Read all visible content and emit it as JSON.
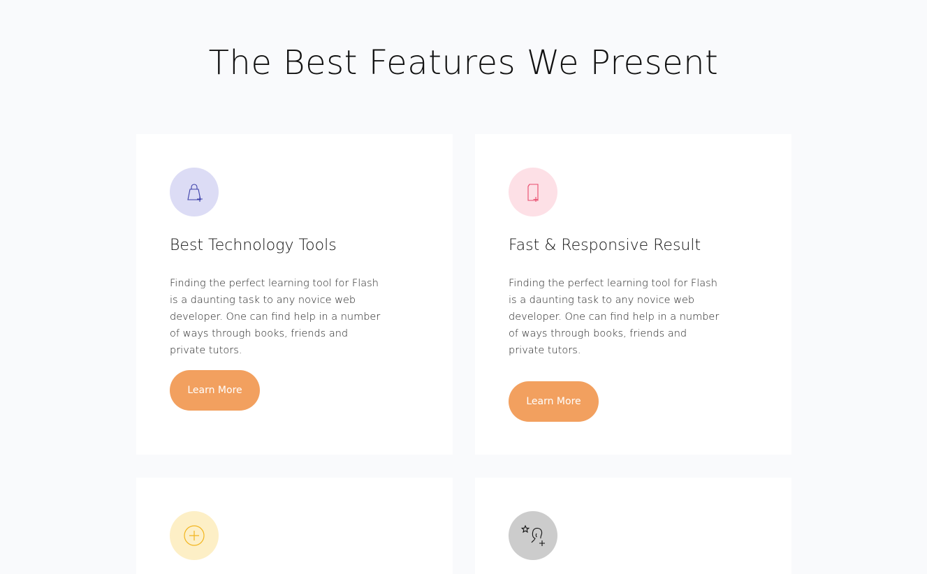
{
  "section": {
    "title": "The Best Features We Present"
  },
  "cards": [
    {
      "icon": "shopping-bag-plus-icon",
      "icon_bg": "#dcdcf5",
      "icon_color": "#3b3fa8",
      "title": "Best Technology Tools",
      "text": "Finding the perfect learning tool for Flash is a daunting task to any novice web developer. One can find help in a number of ways through books, friends and private tutors.",
      "button": "Learn More"
    },
    {
      "icon": "document-plus-icon",
      "icon_bg": "#fde0e6",
      "icon_color": "#e84a6c",
      "title": "Fast & Responsive Result",
      "text": "Finding the perfect learning tool for Flash is a daunting task to any novice web developer. One can find help in a number of ways through books, friends and private tutors.",
      "button": "Learn More"
    },
    {
      "icon": "circle-plus-icon",
      "icon_bg": "#fdefc6",
      "icon_color": "#f2b51e"
    },
    {
      "icon": "person-star-plus-icon",
      "icon_bg": "#cccccc",
      "icon_color": "#111111"
    }
  ],
  "colors": {
    "page_bg": "#f9fafc",
    "card_bg": "#ffffff",
    "button_bg": "#f2a05f",
    "button_text": "#ffffff"
  }
}
